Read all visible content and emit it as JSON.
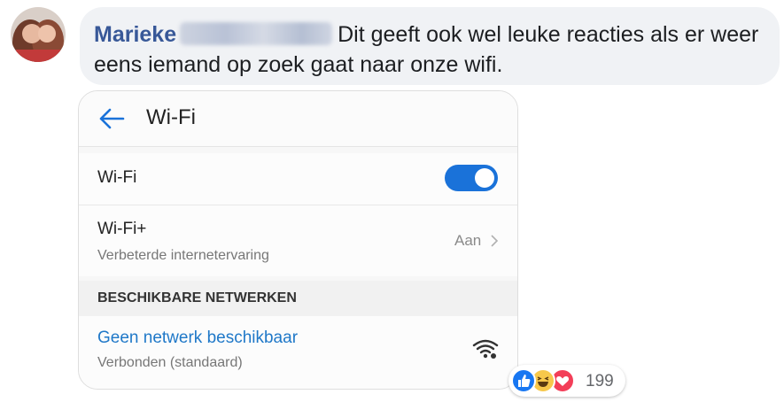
{
  "comment": {
    "author": "Marieke",
    "text": "Dit geeft ook wel leuke reacties als er weer eens iemand op zoek gaat naar onze wifi.",
    "reaction_count": "199",
    "reaction_icons": [
      "like-icon",
      "haha-icon",
      "love-icon"
    ]
  },
  "screenshot": {
    "title": "Wi-Fi",
    "wifi_row": {
      "label": "Wi-Fi",
      "toggle_on": true
    },
    "wifiplus_row": {
      "label": "Wi-Fi+",
      "subtitle": "Verbeterde internetervaring",
      "value": "Aan"
    },
    "section_header": "BESCHIKBARE NETWERKEN",
    "network": {
      "name": "Geen netwerk beschikbaar",
      "status": "Verbonden  (standaard)"
    }
  },
  "colors": {
    "author": "#385898",
    "bubble": "#f0f2f5",
    "toggle": "#1a72d9",
    "network_link": "#1f78c8",
    "like": "#1877f2",
    "love": "#f33e58",
    "haha": "#f7c84b"
  }
}
